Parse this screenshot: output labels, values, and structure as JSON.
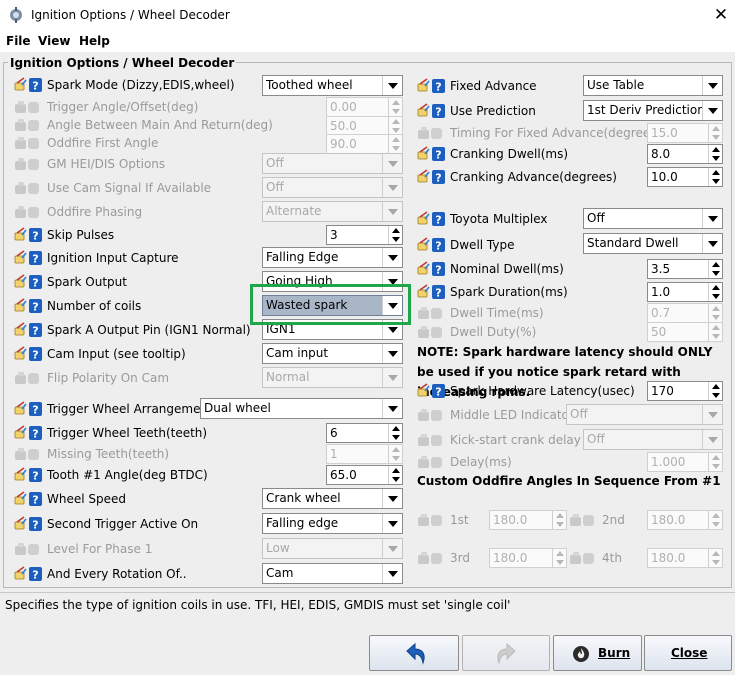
{
  "window": {
    "title": "Ignition Options / Wheel Decoder",
    "close": "✕"
  },
  "menu": [
    "File",
    "View",
    "Help"
  ],
  "group_title": "Ignition Options / Wheel Decoder",
  "left": {
    "spark_mode": {
      "label": "Spark Mode (Dizzy,EDIS,wheel)",
      "value": "Toothed wheel"
    },
    "trigger_angle": {
      "label": "Trigger Angle/Offset(deg)",
      "value": "0.00"
    },
    "angle_between": {
      "label": "Angle Between Main And Return(deg)",
      "value": "50.0"
    },
    "oddfire_first": {
      "label": "Oddfire First Angle",
      "value": "90.0"
    },
    "gm_hei": {
      "label": "GM HEI/DIS Options",
      "value": "Off"
    },
    "use_cam": {
      "label": "Use Cam Signal If Available",
      "value": "Off"
    },
    "oddfire_phasing": {
      "label": "Oddfire Phasing",
      "value": "Alternate"
    },
    "skip_pulses": {
      "label": "Skip Pulses",
      "value": "3"
    },
    "ignition_input": {
      "label": "Ignition Input Capture",
      "value": "Falling Edge"
    },
    "spark_output": {
      "label": "Spark Output",
      "value": "Going High"
    },
    "number_coils": {
      "label": "Number of coils",
      "value": "Wasted spark"
    },
    "spark_a_pin": {
      "label": "Spark A Output Pin (IGN1 Normal)",
      "value": "IGN1"
    },
    "cam_input": {
      "label": "Cam Input (see tooltip)",
      "value": "Cam input"
    },
    "flip_polarity": {
      "label": "Flip Polarity On Cam",
      "value": "Normal"
    },
    "trigger_arrangement": {
      "label": "Trigger Wheel Arrangement",
      "value": "Dual wheel"
    },
    "trigger_teeth": {
      "label": "Trigger Wheel Teeth(teeth)",
      "value": "6"
    },
    "missing_teeth": {
      "label": "Missing Teeth(teeth)",
      "value": "1"
    },
    "tooth1_angle": {
      "label": "Tooth #1 Angle(deg BTDC)",
      "value": "65.0"
    },
    "wheel_speed": {
      "label": "Wheel Speed",
      "value": "Crank wheel"
    },
    "second_trigger": {
      "label": "Second Trigger Active On",
      "value": "Falling edge"
    },
    "level_phase1": {
      "label": "Level For Phase 1",
      "value": "Low"
    },
    "every_rotation": {
      "label": "And Every Rotation Of..",
      "value": "Cam"
    }
  },
  "right": {
    "fixed_advance": {
      "label": "Fixed Advance",
      "value": "Use Table"
    },
    "use_prediction": {
      "label": "Use Prediction",
      "value": "1st Deriv Prediction"
    },
    "timing_fixed": {
      "label": "Timing For Fixed Advance(degrees)",
      "value": "15.0"
    },
    "cranking_dwell": {
      "label": "Cranking Dwell(ms)",
      "value": "8.0"
    },
    "cranking_advance": {
      "label": "Cranking Advance(degrees)",
      "value": "10.0"
    },
    "toyota_multiplex": {
      "label": "Toyota Multiplex",
      "value": "Off"
    },
    "dwell_type": {
      "label": "Dwell Type",
      "value": "Standard Dwell"
    },
    "nominal_dwell": {
      "label": "Nominal Dwell(ms)",
      "value": "3.5"
    },
    "spark_duration": {
      "label": "Spark Duration(ms)",
      "value": "1.0"
    },
    "dwell_time": {
      "label": "Dwell Time(ms)",
      "value": "0.7"
    },
    "dwell_duty": {
      "label": "Dwell Duty(%)",
      "value": "50"
    },
    "note": "NOTE: Spark hardware latency should ONLY be used if you notice spark retard with increasing rpms.",
    "spark_latency": {
      "label": "Spark Hardware Latency(usec)",
      "value": "170"
    },
    "middle_led": {
      "label": "Middle LED Indicator",
      "value": "Off"
    },
    "kickstart": {
      "label": "Kick-start crank delay",
      "value": "Off"
    },
    "delay": {
      "label": "Delay(ms)",
      "value": "1.000"
    },
    "custom_title": "Custom Oddfire Angles In Sequence From #1",
    "first": {
      "label": "1st",
      "value": "180.0"
    },
    "second": {
      "label": "2nd",
      "value": "180.0"
    },
    "third": {
      "label": "3rd",
      "value": "180.0"
    },
    "fourth": {
      "label": "4th",
      "value": "180.0"
    }
  },
  "status": "Specifies the type of ignition coils in use. TFI, HEI, EDIS, GMDIS must set 'single coil'",
  "buttons": {
    "burn": "Burn",
    "close": "Close"
  },
  "colors": {
    "highlight": "#1ea64a",
    "help_icon": "#1d5fbf"
  }
}
